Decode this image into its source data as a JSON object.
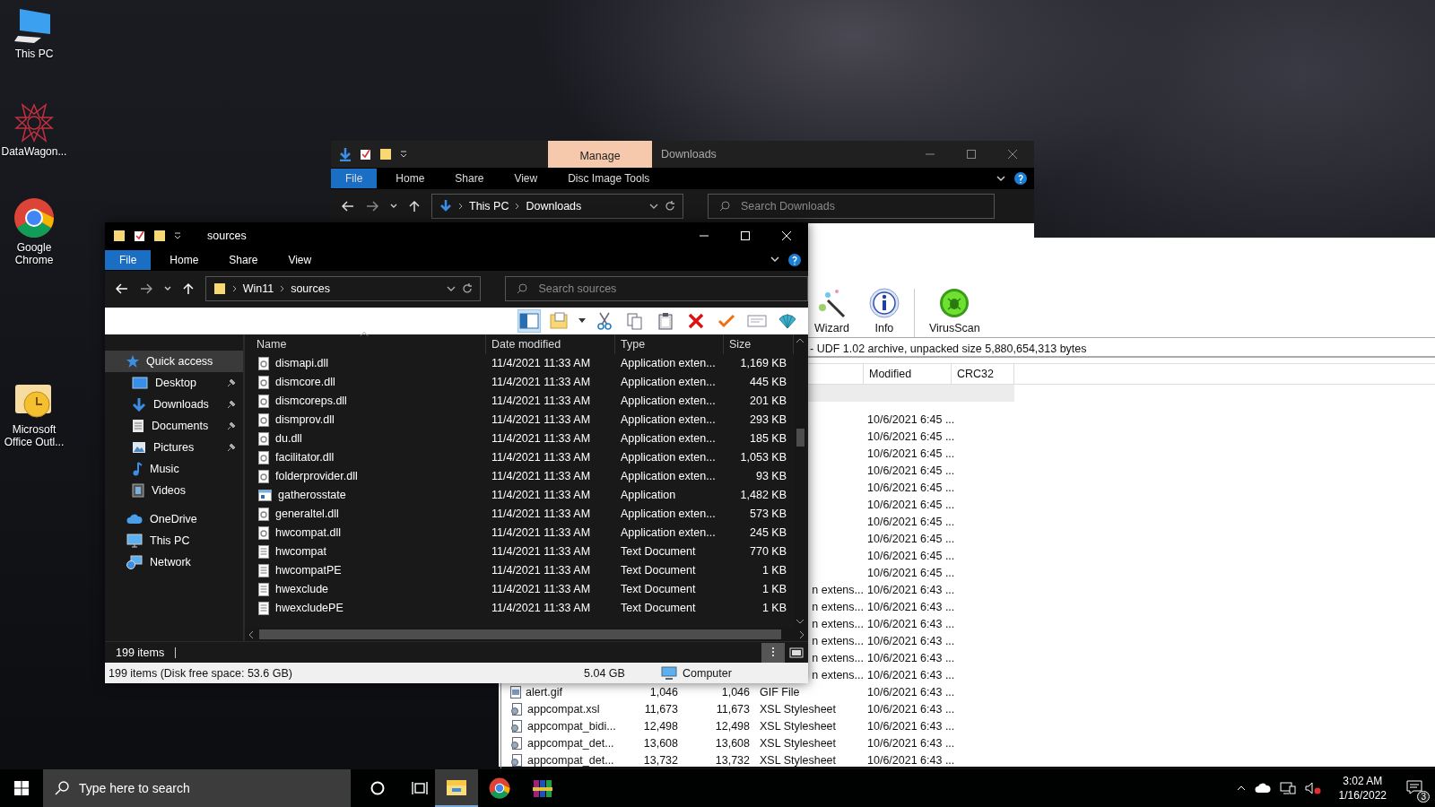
{
  "desktop_icons": [
    {
      "label": "This PC",
      "kind": "pc"
    },
    {
      "label": "DataWagon...",
      "kind": "star"
    },
    {
      "label": "Google Chrome",
      "kind": "chrome"
    },
    {
      "label": "Microsoft Office Outl...",
      "kind": "outlook"
    }
  ],
  "downloads_window": {
    "context_tab": "Manage",
    "title": "Downloads",
    "ribbon_tabs": [
      {
        "label": "File",
        "kind": "file"
      },
      {
        "label": "Home",
        "kind": "tab"
      },
      {
        "label": "Share",
        "kind": "tab"
      },
      {
        "label": "View",
        "kind": "tab"
      },
      {
        "label": "Disc Image Tools",
        "kind": "tab"
      }
    ],
    "path": [
      "This PC",
      "Downloads"
    ],
    "search": {
      "placeholder": "Search Downloads"
    }
  },
  "winrar_window": {
    "toolbar": [
      {
        "label": "Wizard",
        "kind": "wizard"
      },
      {
        "label": "Info",
        "kind": "info"
      },
      {
        "label": "VirusScan",
        "kind": "virus"
      }
    ],
    "info": "- UDF 1.02 archive, unpacked size 5,880,654,313 bytes",
    "columns": [
      "Modified",
      "CRC32"
    ],
    "rows": [
      {
        "kind": "hidden",
        "modified": "10/6/2021 6:45 ..."
      },
      {
        "kind": "hidden",
        "modified": "10/6/2021 6:45 ..."
      },
      {
        "kind": "hidden",
        "modified": "10/6/2021 6:45 ..."
      },
      {
        "kind": "hidden",
        "modified": "10/6/2021 6:45 ..."
      },
      {
        "kind": "hidden",
        "modified": "10/6/2021 6:45 ..."
      },
      {
        "kind": "hidden",
        "modified": "10/6/2021 6:45 ..."
      },
      {
        "kind": "hidden",
        "modified": "10/6/2021 6:45 ..."
      },
      {
        "kind": "hidden",
        "modified": "10/6/2021 6:45 ..."
      },
      {
        "kind": "hidden",
        "modified": "10/6/2021 6:45 ..."
      },
      {
        "kind": "hidden",
        "modified": "10/6/2021 6:45 ..."
      },
      {
        "kind": "partial",
        "type": "n extens...",
        "modified": "10/6/2021 6:43 ..."
      },
      {
        "kind": "partial",
        "type": "n extens...",
        "modified": "10/6/2021 6:43 ..."
      },
      {
        "kind": "partial",
        "type": "n extens...",
        "modified": "10/6/2021 6:43 ..."
      },
      {
        "kind": "partial",
        "type": "n extens...",
        "modified": "10/6/2021 6:43 ..."
      },
      {
        "kind": "partial",
        "type": "n extens...",
        "modified": "10/6/2021 6:43 ..."
      },
      {
        "kind": "partial",
        "type": "n extens...",
        "modified": "10/6/2021 6:43 ..."
      },
      {
        "kind": "gif",
        "name": "alert.gif",
        "size": "1,046",
        "packed": "1,046",
        "type": "GIF File",
        "modified": "10/6/2021 6:43 ..."
      },
      {
        "kind": "xsl",
        "name": "appcompat.xsl",
        "size": "11,673",
        "packed": "11,673",
        "type": "XSL Stylesheet",
        "modified": "10/6/2021 6:43 ..."
      },
      {
        "kind": "xsl",
        "name": "appcompat_bidi...",
        "size": "12,498",
        "packed": "12,498",
        "type": "XSL Stylesheet",
        "modified": "10/6/2021 6:43 ..."
      },
      {
        "kind": "xsl",
        "name": "appcompat_det...",
        "size": "13,608",
        "packed": "13,608",
        "type": "XSL Stylesheet",
        "modified": "10/6/2021 6:43 ..."
      },
      {
        "kind": "xsl",
        "name": "appcompat_det...",
        "size": "13,732",
        "packed": "13,732",
        "type": "XSL Stylesheet",
        "modified": "10/6/2021 6:43 ..."
      }
    ]
  },
  "sources_window": {
    "title": "sources",
    "ribbon_tabs": [
      {
        "label": "File",
        "kind": "file"
      },
      {
        "label": "Home",
        "kind": "tab"
      },
      {
        "label": "Share",
        "kind": "tab"
      },
      {
        "label": "View",
        "kind": "tab"
      }
    ],
    "path": [
      "Win11",
      "sources"
    ],
    "search": {
      "placeholder": "Search sources"
    },
    "toolbar": [
      {
        "kind": "pane",
        "selected": true
      },
      {
        "kind": "folder",
        "selected": false
      },
      {
        "kind": "cut",
        "selected": false
      },
      {
        "kind": "copy",
        "selected": false
      },
      {
        "kind": "paste",
        "selected": false
      },
      {
        "kind": "delete",
        "selected": false
      },
      {
        "kind": "check",
        "selected": false
      },
      {
        "kind": "mail",
        "selected": false
      },
      {
        "kind": "shell",
        "selected": false
      }
    ],
    "nav": [
      {
        "label": "Quick access",
        "kind": "star",
        "selected": true,
        "pinned": false,
        "children": [
          {
            "label": "Desktop",
            "kind": "desktop",
            "selected": false,
            "pinned": true
          },
          {
            "label": "Downloads",
            "kind": "download",
            "selected": false,
            "pinned": true
          },
          {
            "label": "Documents",
            "kind": "documents",
            "selected": false,
            "pinned": true
          },
          {
            "label": "Pictures",
            "kind": "pictures",
            "selected": false,
            "pinned": true
          },
          {
            "label": "Music",
            "kind": "music",
            "selected": false,
            "pinned": false
          },
          {
            "label": "Videos",
            "kind": "videos",
            "selected": false,
            "pinned": false
          }
        ]
      },
      {
        "label": "OneDrive",
        "kind": "cloud",
        "selected": false,
        "pinned": false
      },
      {
        "label": "This PC",
        "kind": "pc",
        "selected": false,
        "pinned": false
      },
      {
        "label": "Network",
        "kind": "network",
        "selected": false,
        "pinned": false
      }
    ],
    "columns": [
      "Name",
      "Date modified",
      "Type",
      "Size"
    ],
    "rows": [
      {
        "kind": "dll",
        "name": "dismapi.dll",
        "date": "11/4/2021 11:33 AM",
        "type": "Application exten...",
        "size": "1,169 KB"
      },
      {
        "kind": "dll",
        "name": "dismcore.dll",
        "date": "11/4/2021 11:33 AM",
        "type": "Application exten...",
        "size": "445 KB"
      },
      {
        "kind": "dll",
        "name": "dismcoreps.dll",
        "date": "11/4/2021 11:33 AM",
        "type": "Application exten...",
        "size": "201 KB"
      },
      {
        "kind": "dll",
        "name": "dismprov.dll",
        "date": "11/4/2021 11:33 AM",
        "type": "Application exten...",
        "size": "293 KB"
      },
      {
        "kind": "dll",
        "name": "du.dll",
        "date": "11/4/2021 11:33 AM",
        "type": "Application exten...",
        "size": "185 KB"
      },
      {
        "kind": "dll",
        "name": "facilitator.dll",
        "date": "11/4/2021 11:33 AM",
        "type": "Application exten...",
        "size": "1,053 KB"
      },
      {
        "kind": "dll",
        "name": "folderprovider.dll",
        "date": "11/4/2021 11:33 AM",
        "type": "Application exten...",
        "size": "93 KB"
      },
      {
        "kind": "app",
        "name": "gatherosstate",
        "date": "11/4/2021 11:33 AM",
        "type": "Application",
        "size": "1,482 KB"
      },
      {
        "kind": "dll",
        "name": "generaltel.dll",
        "date": "11/4/2021 11:33 AM",
        "type": "Application exten...",
        "size": "573 KB"
      },
      {
        "kind": "dll",
        "name": "hwcompat.dll",
        "date": "11/4/2021 11:33 AM",
        "type": "Application exten...",
        "size": "245 KB"
      },
      {
        "kind": "txt",
        "name": "hwcompat",
        "date": "11/4/2021 11:33 AM",
        "type": "Text Document",
        "size": "770 KB"
      },
      {
        "kind": "txt",
        "name": "hwcompatPE",
        "date": "11/4/2021 11:33 AM",
        "type": "Text Document",
        "size": "1 KB"
      },
      {
        "kind": "txt",
        "name": "hwexclude",
        "date": "11/4/2021 11:33 AM",
        "type": "Text Document",
        "size": "1 KB"
      },
      {
        "kind": "txt",
        "name": "hwexcludePE",
        "date": "11/4/2021 11:33 AM",
        "type": "Text Document",
        "size": "1 KB"
      }
    ],
    "item_count": "199 items",
    "status": {
      "summary": "199 items (Disk free space: 53.6 GB)",
      "size": "5.04 GB",
      "location": "Computer"
    }
  },
  "taskbar": {
    "search": {
      "placeholder": "Type here to search"
    },
    "apps": [
      {
        "kind": "explorer",
        "selected": true
      },
      {
        "kind": "chrome",
        "selected": false
      },
      {
        "kind": "winrar",
        "selected": false
      }
    ],
    "time": "3:02 AM",
    "date": "1/16/2022",
    "notifications": "3"
  }
}
